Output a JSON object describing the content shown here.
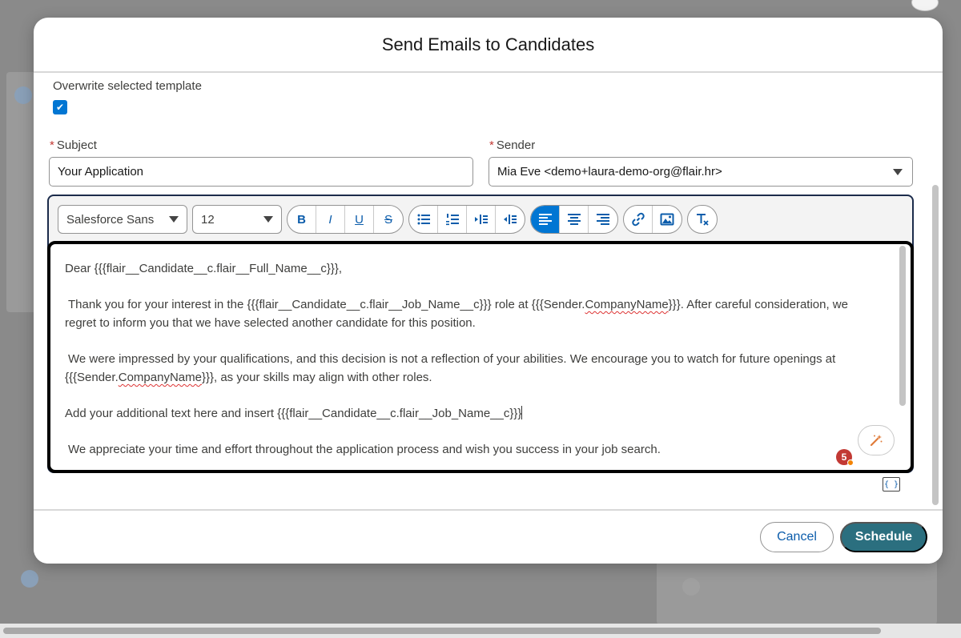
{
  "modal": {
    "title": "Send Emails to Candidates"
  },
  "form": {
    "overwrite_label": "Overwrite selected template",
    "overwrite_checked": true,
    "subject_label": "Subject",
    "subject_value": "Your Application",
    "sender_label": "Sender",
    "sender_value": "Mia Eve <demo+laura-demo-org@flair.hr>",
    "required_marker": "*"
  },
  "editor": {
    "font_family": "Salesforce Sans",
    "font_size": "12",
    "toolbar_icons": {
      "bold": "B",
      "italic": "I",
      "underline": "U",
      "strikethrough": "S"
    },
    "body": {
      "p1": "Dear {{{flair__Candidate__c.flair__Full_Name__c}}},",
      "p2_a": "Thank you for your interest in the {{{flair__Candidate__c.flair__Job_Name__c}}} role at {{{Sender.",
      "p2_company": "CompanyName",
      "p2_b": "}}}. After careful consideration, we regret to inform you that we have selected another candidate for this position.",
      "p3_a": "We were impressed by your qualifications, and this decision is not a reflection of your abilities. We encourage you to watch for future openings at {{{Sender.",
      "p3_company": "CompanyName",
      "p3_b": "}}}, as your skills may align with other roles.",
      "p4": "Add your additional text here and insert {{{flair__Candidate__c.flair__Job_Name__c}}}",
      "p5": "We appreciate your time and effort throughout the application process and wish you success in your job search."
    },
    "notification_count": "5",
    "merge_field_label": "{ }"
  },
  "footer": {
    "cancel_label": "Cancel",
    "schedule_label": "Schedule"
  },
  "colors": {
    "brand_blue": "#0176d3",
    "schedule_teal": "#2b6f7f",
    "required_red": "#c23934"
  }
}
